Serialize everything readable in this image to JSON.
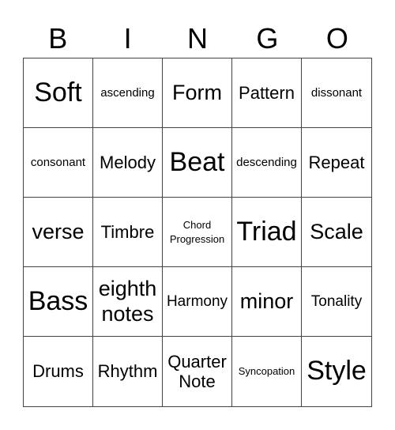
{
  "header": [
    "B",
    "I",
    "N",
    "G",
    "O"
  ],
  "cells": [
    {
      "text": "Soft",
      "size": "s-xl"
    },
    {
      "text": "ascending",
      "size": "s-s"
    },
    {
      "text": "Form",
      "size": "s-l"
    },
    {
      "text": "Pattern",
      "size": "s-m"
    },
    {
      "text": "dissonant",
      "size": "s-s"
    },
    {
      "text": "consonant",
      "size": "s-s"
    },
    {
      "text": "Melody",
      "size": "s-m"
    },
    {
      "text": "Beat",
      "size": "s-xl"
    },
    {
      "text": "descending",
      "size": "s-s"
    },
    {
      "text": "Repeat",
      "size": "s-m"
    },
    {
      "text": "verse",
      "size": "s-l"
    },
    {
      "text": "Timbre",
      "size": "s-m"
    },
    {
      "text": "Chord Progression",
      "size": "s-xs"
    },
    {
      "text": "Triad",
      "size": "s-xl"
    },
    {
      "text": "Scale",
      "size": "s-l"
    },
    {
      "text": "Bass",
      "size": "s-xl"
    },
    {
      "text": "eighth notes",
      "size": "s-l"
    },
    {
      "text": "Harmony",
      "size": "s-ms"
    },
    {
      "text": "minor",
      "size": "s-l"
    },
    {
      "text": "Tonality",
      "size": "s-ms"
    },
    {
      "text": "Drums",
      "size": "s-m"
    },
    {
      "text": "Rhythm",
      "size": "s-m"
    },
    {
      "text": "Quarter Note",
      "size": "s-m"
    },
    {
      "text": "Syncopation",
      "size": "s-xs"
    },
    {
      "text": "Style",
      "size": "s-xl"
    }
  ]
}
